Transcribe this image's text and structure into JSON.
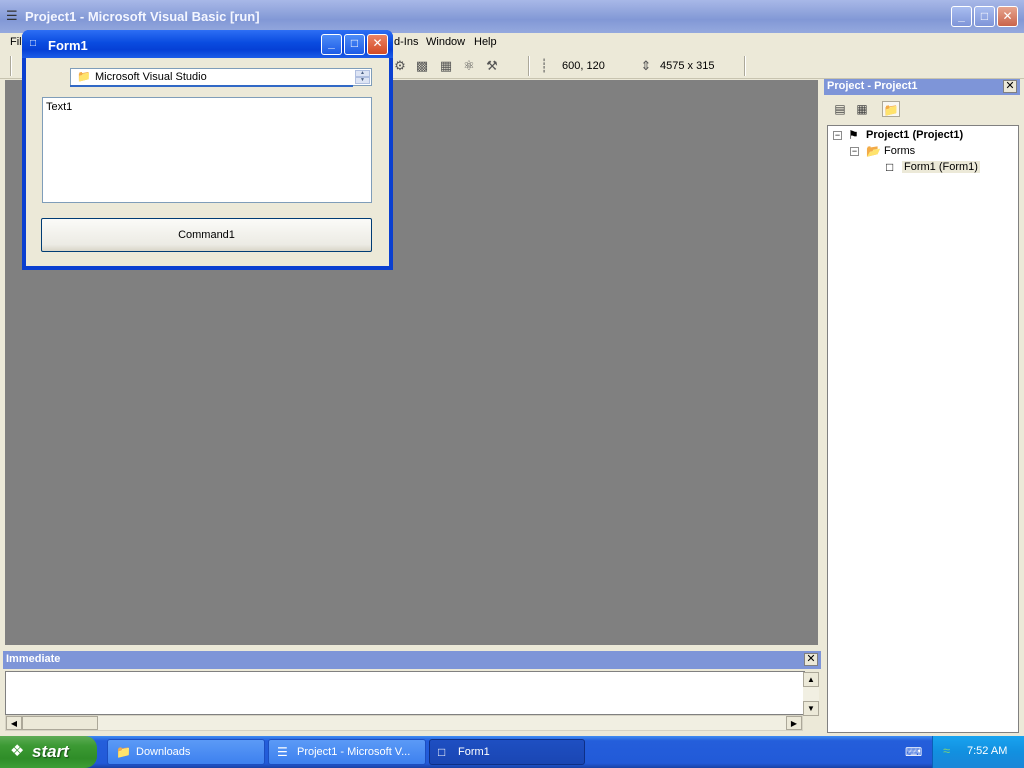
{
  "main_window": {
    "title": "Project1 - Microsoft Visual Basic [run]",
    "menu": {
      "file_partial": "Fil",
      "addins_partial": "d-Ins",
      "window": "Window",
      "help": "Help"
    },
    "toolbar": {
      "position": "600, 120",
      "size": "4575 x 315"
    }
  },
  "project_explorer": {
    "title": "Project - Project1",
    "tree": {
      "project": "Project1 (Project1)",
      "forms_folder": "Forms",
      "form": "Form1 (Form1)"
    }
  },
  "immediate": {
    "title": "Immediate"
  },
  "form1": {
    "title": "Form1",
    "dir_list_value": "Microsoft Visual Studio",
    "textbox_value": "Text1",
    "command_label": "Command1"
  },
  "taskbar": {
    "start_label": "start",
    "items": [
      {
        "label": "Downloads"
      },
      {
        "label": "Project1 - Microsoft V..."
      },
      {
        "label": "Form1"
      }
    ],
    "clock": "7:52 AM"
  }
}
